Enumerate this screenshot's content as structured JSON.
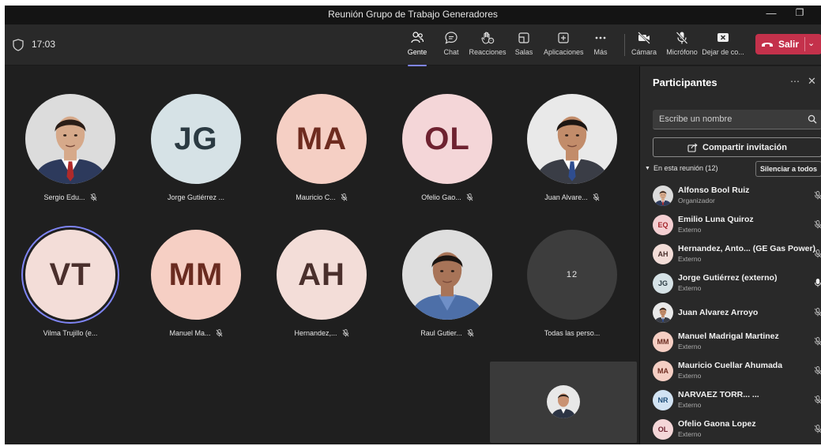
{
  "window": {
    "title": "Reunión Grupo de Trabajo Generadores",
    "minimize_icon": "minimize-icon",
    "maximize_icon": "maximize-icon"
  },
  "toolbar": {
    "time": "17:03",
    "items": [
      {
        "label": "Gente",
        "icon": "people-icon",
        "active": true
      },
      {
        "label": "Chat",
        "icon": "chat-icon"
      },
      {
        "label": "Reacciones",
        "icon": "raise-hand-icon"
      },
      {
        "label": "Salas",
        "icon": "rooms-icon"
      },
      {
        "label": "Aplicaciones",
        "icon": "apps-icon"
      },
      {
        "label": "Más",
        "icon": "more-icon"
      },
      {
        "label": "Cámara",
        "icon": "camera-off-icon"
      },
      {
        "label": "Micrófono",
        "icon": "mic-off-icon"
      },
      {
        "label": "Dejar de co...",
        "icon": "stop-share-icon"
      }
    ],
    "leave_label": "Salir"
  },
  "gallery": {
    "tiles": [
      {
        "name": "Sergio Edu...",
        "type": "photo",
        "muted": true
      },
      {
        "name": "Jorge Gutiérrez ...",
        "initials": "JG",
        "bg": "#d6e2e6",
        "fg": "#2b3a42",
        "muted": false
      },
      {
        "name": "Mauricio C...",
        "initials": "MA",
        "bg": "#f5cfc4",
        "fg": "#6e2b1f",
        "muted": true
      },
      {
        "name": "Ofelio Gao...",
        "initials": "OL",
        "bg": "#f4d6d8",
        "fg": "#6e2230",
        "muted": true
      },
      {
        "name": "Juan Alvare...",
        "type": "photo",
        "muted": true
      },
      {
        "name": "Vilma Trujillo (e...",
        "initials": "VT",
        "bg": "#f3ddd8",
        "fg": "#4a2f2c",
        "muted": false,
        "speaking": true
      },
      {
        "name": "Manuel Ma...",
        "initials": "MM",
        "bg": "#f6cfc4",
        "fg": "#6a2b20",
        "muted": true
      },
      {
        "name": "Hernandez,...",
        "initials": "AH",
        "bg": "#f3ddd8",
        "fg": "#4a2f2c",
        "muted": true
      },
      {
        "name": "Raul Gutier...",
        "type": "photo",
        "muted": true
      },
      {
        "name": "Todas las perso...",
        "count": "12",
        "bg": "#3d3d3d",
        "fg": "#e6e6e6",
        "muted": false
      }
    ]
  },
  "panel": {
    "title": "Participantes",
    "more_icon": "more-icon",
    "close_icon": "close-icon",
    "search_placeholder": "Escribe un nombre",
    "share_label": "Compartir invitación",
    "in_meeting_label": "En esta reunión (12)",
    "mute_all_label": "Silenciar a todos",
    "participants": [
      {
        "name": "Alfonso Bool Ruiz",
        "role": "Organizador",
        "photo": true,
        "mic": "muted"
      },
      {
        "name": "Emilio Luna Quiroz",
        "role": "Externo",
        "initials": "EQ",
        "bg": "#f4cfd2",
        "fg": "#a4262c",
        "mic": "muted"
      },
      {
        "name": "Hernandez, Anto... (GE Gas Power)",
        "role": "Externo",
        "initials": "AH",
        "bg": "#f3ddd8",
        "fg": "#4a2f2c",
        "mic": "muted"
      },
      {
        "name": "Jorge Gutiérrez (externo)",
        "role": "Externo",
        "initials": "JG",
        "bg": "#d6e2e6",
        "fg": "#2b3a42",
        "mic": "on"
      },
      {
        "name": "Juan Alvarez Arroyo",
        "role": "",
        "photo": true,
        "mic": "muted"
      },
      {
        "name": "Manuel Madrigal Martinez",
        "role": "Externo",
        "initials": "MM",
        "bg": "#f6cfc4",
        "fg": "#6a2b20",
        "mic": "muted"
      },
      {
        "name": "Mauricio Cuellar Ahumada",
        "role": "Externo",
        "initials": "MA",
        "bg": "#f5cfc4",
        "fg": "#6e2b1f",
        "mic": "muted"
      },
      {
        "name": "NARVAEZ TORR... ...",
        "role": "Externo",
        "initials": "NR",
        "bg": "#d2e3f3",
        "fg": "#1f4e79",
        "mic": "muted"
      },
      {
        "name": "Ofelio Gaona Lopez",
        "role": "Externo",
        "initials": "OL",
        "bg": "#f4d6d8",
        "fg": "#6e2230",
        "mic": "muted"
      }
    ]
  },
  "colors": {
    "accent": "#7f85f5",
    "leave": "#c4314b",
    "stage_bg": "#1f1f1f",
    "panel_bg": "#292929"
  }
}
